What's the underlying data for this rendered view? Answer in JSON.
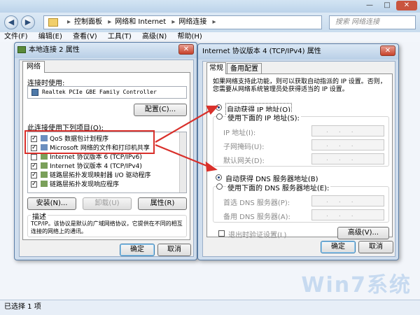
{
  "explorer": {
    "address": {
      "crumbs": [
        "控制面板",
        "网络和 Internet",
        "网络连接"
      ]
    },
    "search_placeholder": "搜索 网络连接",
    "menu": [
      "文件(F)",
      "编辑(E)",
      "查看(V)",
      "工具(T)",
      "高级(N)",
      "帮助(H)"
    ],
    "status_text": "已选择 1 项",
    "watermark": "Win7系统"
  },
  "props_dialog": {
    "title": "本地连接 2 属性",
    "tab": "网络",
    "connect_using_label": "连接时使用:",
    "adapter_name": "Realtek PCIe GBE Family Controller",
    "configure_button": "配置(C)...",
    "items_label": "此连接使用下列项目(O):",
    "items": [
      {
        "text": "QoS 数据包计划程序",
        "checked": true
      },
      {
        "text": "Microsoft 网络的文件和打印机共享",
        "checked": true
      },
      {
        "text": "Internet 协议版本 6 (TCP/IPv6)",
        "checked": false
      },
      {
        "text": "Internet 协议版本 4 (TCP/IPv4)",
        "checked": true
      },
      {
        "text": "链路层拓扑发现映射器 I/O 驱动程序",
        "checked": true
      },
      {
        "text": "链路层拓扑发现响应程序",
        "checked": true
      }
    ],
    "install_button": "安装(N)...",
    "uninstall_button": "卸载(U)",
    "properties_button": "属性(R)",
    "description_label": "描述",
    "description_text": "TCP/IP。该协议是默认的广域网络协议，它提供在不同的相互连接的网络上的通讯。",
    "ok_button": "确定",
    "cancel_button": "取消"
  },
  "ipv4_dialog": {
    "title": "Internet 协议版本 4 (TCP/IPv4) 属性",
    "tabs": [
      "常规",
      "备用配置"
    ],
    "intro": "如果网络支持此功能，则可以获取自动指派的 IP 设置。否则，您需要从网络系统管理员处获得适当的 IP 设置。",
    "auto_ip": "自动获得 IP 地址(O)",
    "manual_ip": "使用下面的 IP 地址(S):",
    "ip_address_label": "IP 地址(I):",
    "subnet_label": "子网掩码(U):",
    "gateway_label": "默认网关(D):",
    "auto_dns": "自动获得 DNS 服务器地址(B)",
    "manual_dns": "使用下面的 DNS 服务器地址(E):",
    "preferred_dns_label": "首选 DNS 服务器(P):",
    "alternate_dns_label": "备用 DNS 服务器(A):",
    "validate_label": "退出时验证设置(L)",
    "advanced_button": "高级(V)...",
    "ok_button": "确定",
    "cancel_button": "取消"
  },
  "colors": {
    "highlight_red": "#d9302b"
  }
}
